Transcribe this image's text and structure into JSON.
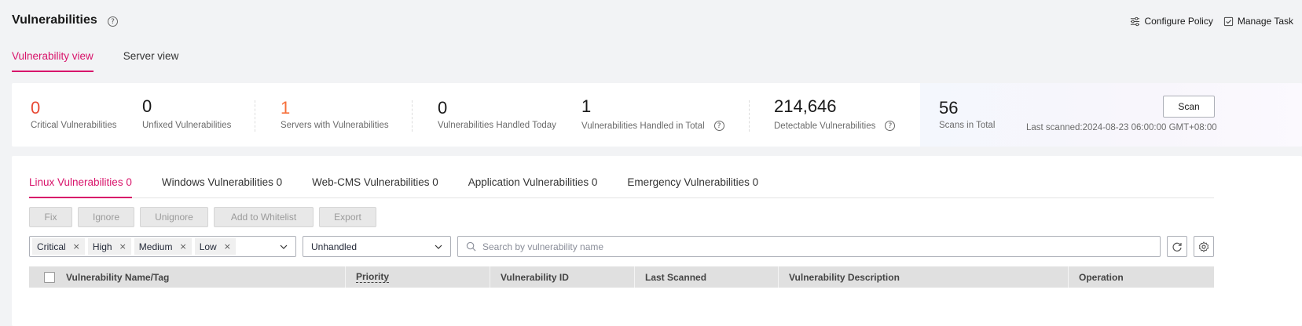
{
  "header": {
    "title": "Vulnerabilities",
    "help_glyph": "?",
    "actions": {
      "configure_policy": "Configure Policy",
      "manage_task": "Manage Task"
    }
  },
  "view_tabs": [
    {
      "label": "Vulnerability view",
      "active": true
    },
    {
      "label": "Server view",
      "active": false
    }
  ],
  "stats": {
    "critical": {
      "value": "0",
      "label": "Critical Vulnerabilities"
    },
    "unfixed": {
      "value": "0",
      "label": "Unfixed Vulnerabilities"
    },
    "servers": {
      "value": "1",
      "label": "Servers with Vulnerabilities"
    },
    "handled_today": {
      "value": "0",
      "label": "Vulnerabilities Handled Today"
    },
    "handled_total": {
      "value": "1",
      "label": "Vulnerabilities Handled in Total"
    },
    "detectable": {
      "value": "214,646",
      "label": "Detectable Vulnerabilities"
    },
    "scans": {
      "value": "56",
      "label": "Scans in Total"
    },
    "scan_button": "Scan",
    "last_scanned": "Last scanned:2024-08-23 06:00:00 GMT+08:00"
  },
  "vul_tabs": [
    {
      "label": "Linux Vulnerabilities 0",
      "active": true
    },
    {
      "label": "Windows Vulnerabilities 0",
      "active": false
    },
    {
      "label": "Web-CMS Vulnerabilities 0",
      "active": false
    },
    {
      "label": "Application Vulnerabilities 0",
      "active": false
    },
    {
      "label": "Emergency Vulnerabilities 0",
      "active": false
    }
  ],
  "action_buttons": {
    "fix": "Fix",
    "ignore": "Ignore",
    "unignore": "Unignore",
    "whitelist": "Add to Whitelist",
    "export": "Export"
  },
  "filters": {
    "severity_tags": [
      "Critical",
      "High",
      "Medium",
      "Low"
    ],
    "tag_close": "×",
    "status": "Unhandled",
    "search_placeholder": "Search by vulnerability name"
  },
  "table": {
    "columns": [
      "Vulnerability Name/Tag",
      "Priority",
      "Vulnerability ID",
      "Last Scanned",
      "Vulnerability Description",
      "Operation"
    ]
  },
  "colors": {
    "accent": "#d8136a",
    "critical": "#e84a35",
    "warning": "#f66f3a"
  },
  "icons": [
    "help-icon",
    "sliders-icon",
    "checkbox-task-icon",
    "chevron-down-icon",
    "search-icon",
    "refresh-icon",
    "settings-icon"
  ]
}
